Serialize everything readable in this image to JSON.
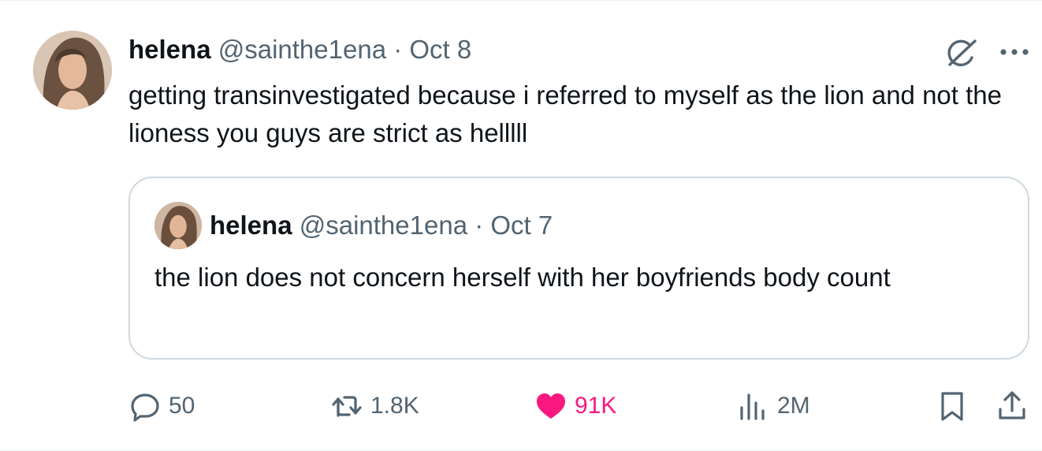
{
  "tweet": {
    "author_name": "helena",
    "author_handle": "@sainthe1ena",
    "separator": "·",
    "date": "Oct 8",
    "text": "getting transinvestigated because i referred to myself as the lion and not the lioness you guys are strict as helllll"
  },
  "quoted": {
    "author_name": "helena",
    "author_handle": "@sainthe1ena",
    "separator": "·",
    "date": "Oct 7",
    "text": "the lion does not concern herself with her boyfriends body count"
  },
  "actions": {
    "replies": "50",
    "retweets": "1.8K",
    "likes": "91K",
    "views": "2M"
  },
  "icons": {
    "header": [
      "grok-icon",
      "more-icon"
    ],
    "actions": [
      "reply-icon",
      "retweet-icon",
      "heart-icon",
      "views-icon",
      "bookmark-icon",
      "share-icon"
    ]
  },
  "colors": {
    "text": "#0f1419",
    "secondary": "#536471",
    "like": "#f91880",
    "border": "#cfd9de"
  }
}
